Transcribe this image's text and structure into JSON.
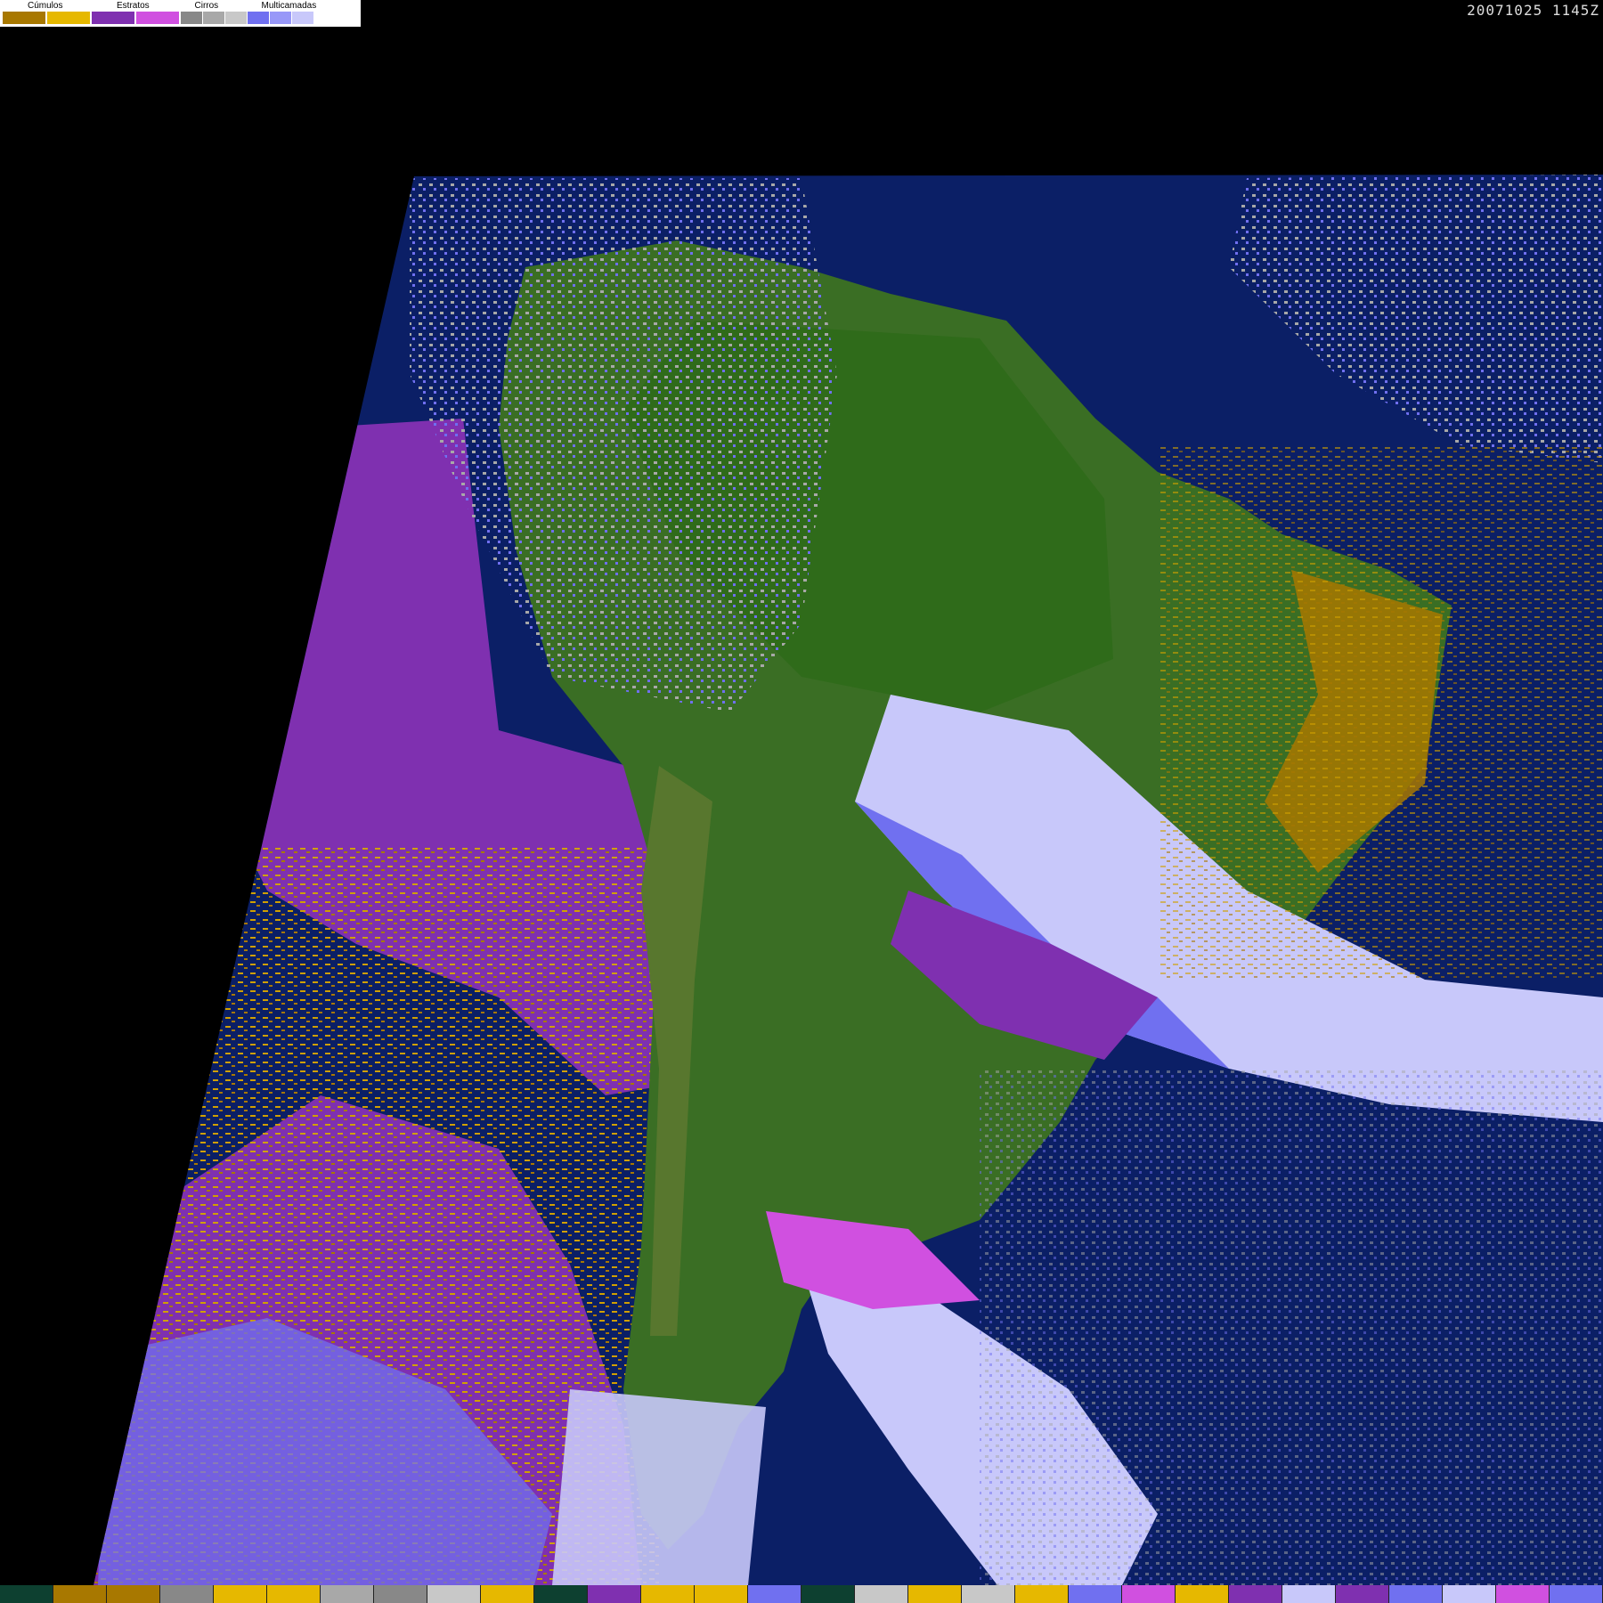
{
  "legend": {
    "groups": [
      {
        "label": "Cúmulos",
        "colors": [
          "#a87800",
          "#e6b800"
        ]
      },
      {
        "label": "Estratos",
        "colors": [
          "#7f30b0",
          "#d050e0"
        ]
      },
      {
        "label": "Cirros",
        "colors": [
          "#888888",
          "#a8a8a8",
          "#c8c8c8"
        ]
      },
      {
        "label": "Multicamadas",
        "colors": [
          "#7070f0",
          "#9898f8",
          "#c8c8fa"
        ]
      }
    ]
  },
  "timestamp": "20071025 1145Z",
  "map": {
    "ocean_color": "#0b1f66",
    "land_color": "#3a6e24",
    "stratus_color": "#7f30b0",
    "cumulus_color": "#d0a000",
    "multilayer_color": "#c8c8fa"
  },
  "bottom_bar": {
    "colors": [
      "#0d4030",
      "#a87800",
      "#a87800",
      "#888888",
      "#e6b800",
      "#e6b800",
      "#a8a8a8",
      "#888888",
      "#c8c8c8",
      "#e6b800",
      "#0d4030",
      "#7f30b0",
      "#e6b800",
      "#e6b800",
      "#7070f0",
      "#0d4030",
      "#c8c8c8",
      "#e6b800",
      "#c8c8c8",
      "#e6b800",
      "#7070f0",
      "#d050e0",
      "#e6b800",
      "#7f30b0",
      "#c8c8fa",
      "#7f30b0",
      "#7070f0",
      "#c8c8fa",
      "#d050e0",
      "#7070f0"
    ]
  }
}
